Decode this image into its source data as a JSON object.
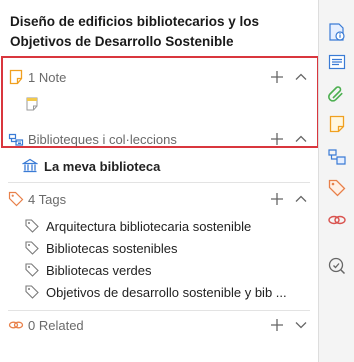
{
  "item": {
    "title": "Diseño de edificios bibliotecarios y los Objetivos de Desarrollo Sostenible"
  },
  "notes": {
    "header": "1 Note"
  },
  "collections": {
    "header": "Biblioteques i col·leccions",
    "items": [
      {
        "label": "La meva biblioteca"
      }
    ]
  },
  "tags": {
    "header": "4 Tags",
    "items": [
      {
        "label": "Arquitectura bibliotecaria sostenible"
      },
      {
        "label": "Bibliotecas sostenibles"
      },
      {
        "label": "Bibliotecas verdes"
      },
      {
        "label": "Objetivos de desarrollo sostenible y bib ..."
      }
    ]
  },
  "related": {
    "header": "0 Related"
  },
  "colors": {
    "highlight_border": "#d9363e",
    "note_yellow": "#f0a020",
    "tag_orange": "#e8804a",
    "collection_blue": "#3a7bd5",
    "attachment_green": "#4caf50",
    "related_red": "#d9534f"
  },
  "sidebar_icons": [
    "info-icon",
    "abstract-icon",
    "attachments-icon",
    "notes-icon",
    "libraries-collections-icon",
    "tags-icon",
    "related-icon",
    "locate-icon"
  ]
}
